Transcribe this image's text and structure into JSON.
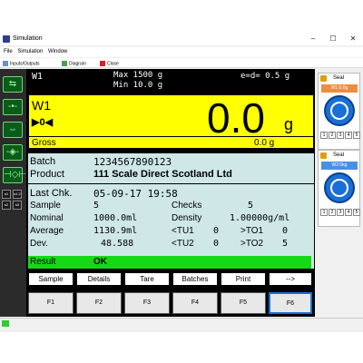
{
  "window": {
    "title": "Simulation",
    "min": "–",
    "max": "☐",
    "close": "✕"
  },
  "menu": {
    "file": "File",
    "simulation": "Simulation",
    "window": "Window"
  },
  "toolbar": {
    "io": "Inputs/Outputs",
    "diagram": "Diagram",
    "close": "Close"
  },
  "header": {
    "id": "W1",
    "max": "Max 1500 g",
    "min": "Min 10.0 g",
    "e": "e=d= 0.5 g"
  },
  "display": {
    "w": "W1",
    "zero": "▶0◀",
    "value": "0.0",
    "unit": "g",
    "gross": "Gross",
    "gross_value": "0.0 g"
  },
  "info": {
    "batch_label": "Batch",
    "batch_value": "1234567890123",
    "product_label": "Product",
    "product_value": "111  Scale Direct Scotland Ltd",
    "lastchk_label": "Last Chk.",
    "lastchk_value": "05-09-17  19:58",
    "sample_label": "Sample",
    "sample_value": "5",
    "checks_label": "Checks",
    "checks_value": "5",
    "nominal_label": "Nominal",
    "nominal_value": "1000.0ml",
    "density_label": "Density",
    "density_value": "1.00000g/ml",
    "average_label": "Average",
    "average_value": "1130.9ml",
    "tu1_label": "<TU1",
    "tu1_value": "0",
    "to1_label": ">TO1",
    "to1_value": "0",
    "dev_label": "Dev.",
    "dev_value": "48.588",
    "tu2_label": "<TU2",
    "tu2_value": "0",
    "to2_label": ">TO2",
    "to2_value": "5",
    "result_label": "Result",
    "result_value": "OK"
  },
  "softkeys": [
    "Sample",
    "Details",
    "Tare",
    "Batches",
    "Print",
    "-->"
  ],
  "fkeys": [
    "F1",
    "F2",
    "F3",
    "F4",
    "F5",
    "F6"
  ],
  "left_buttons": [
    "⇆",
    "-•-",
    "⇔",
    "-◈-",
    "⊣◇⊢"
  ],
  "left_small": [
    "s1",
    "s1.2",
    "s2",
    "s3"
  ],
  "seals": [
    {
      "label": "Seal",
      "name": "W1:0.0g",
      "keys": [
        "1",
        "2",
        "3",
        "4",
        "5"
      ]
    },
    {
      "label": "Seal",
      "name": "W2:0kg",
      "keys": [
        "1",
        "2",
        "3",
        "4",
        "5"
      ]
    }
  ],
  "colors": {
    "display_bg": "#ffff00",
    "screen_bg": "#000000",
    "info_bg": "#cfe7e7",
    "result_bg": "#16d916",
    "green_btn": "#0a5c1a",
    "knob": "#1a6fd6"
  }
}
